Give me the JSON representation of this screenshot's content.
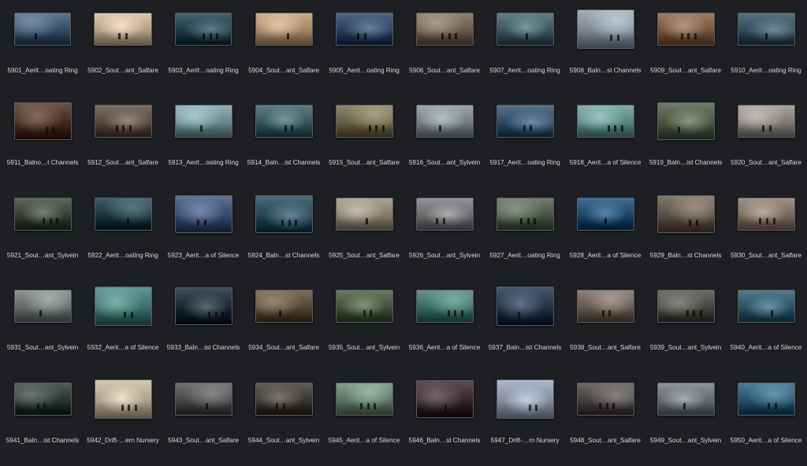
{
  "browser": {
    "items": [
      {
        "name": "5901_Aerit…oating Ring",
        "theme": "#3a5268"
      },
      {
        "name": "5902_Sout…ant_Salfare",
        "theme": "#b8a58a"
      },
      {
        "name": "5903_Aerit…oating Ring",
        "theme": "#23414a"
      },
      {
        "name": "5904_Sout…ant_Salfare",
        "theme": "#a88a68"
      },
      {
        "name": "5905_Aerit…oating Ring",
        "theme": "#2d4460"
      },
      {
        "name": "5906_Sout…ant_Salfare",
        "theme": "#6e5f50"
      },
      {
        "name": "5907_Aerit…oating Ring",
        "theme": "#3e5a63"
      },
      {
        "name": "5908_Baln…st Channels",
        "theme": "#7f8c95"
      },
      {
        "name": "5909_Sout…ant_Salfare",
        "theme": "#7a5a42"
      },
      {
        "name": "5910_Aerit…oating Ring",
        "theme": "#36505e"
      },
      {
        "name": "5911_Balno…t Channels",
        "theme": "#4a3024"
      },
      {
        "name": "5912_Sout…ant_Salfare",
        "theme": "#5a4c40"
      },
      {
        "name": "5913_Aerit…oating Ring",
        "theme": "#6f8d90"
      },
      {
        "name": "5914_Baln…ist Channels",
        "theme": "#3c5b60"
      },
      {
        "name": "5915_Sout…ant_Salfare",
        "theme": "#6b6448"
      },
      {
        "name": "5916_Sout…ant_Sylvein",
        "theme": "#7a8488"
      },
      {
        "name": "5917_Aerit…oating Ring",
        "theme": "#33506b"
      },
      {
        "name": "5918_Aerit…a of Silence",
        "theme": "#5d8a85"
      },
      {
        "name": "5919_Baln…ist Channels",
        "theme": "#4f5a46"
      },
      {
        "name": "5920_Sout…ant_Salfare",
        "theme": "#85807a"
      },
      {
        "name": "5921_Sout…ant_Sylvein",
        "theme": "#3a4438"
      },
      {
        "name": "5922_Aerit…oating Ring",
        "theme": "#1e3a44"
      },
      {
        "name": "5923_Aerit…a of Silence",
        "theme": "#3b4f73"
      },
      {
        "name": "5924_Baln…st Channels",
        "theme": "#2a4a5a"
      },
      {
        "name": "5925_Sout…ant_Salfare",
        "theme": "#8a8070"
      },
      {
        "name": "5926_Sout…ant_Sylvein",
        "theme": "#6e7072"
      },
      {
        "name": "5927_Aerit…oating Ring",
        "theme": "#4e5a48"
      },
      {
        "name": "5928_Aerit…a of Silence",
        "theme": "#1f4a6e"
      },
      {
        "name": "5929_Baln…st Channels",
        "theme": "#5e5448"
      },
      {
        "name": "5930_Sout…ant_Salfare",
        "theme": "#7d6e62"
      },
      {
        "name": "5931_Sout…ant_Sylvein",
        "theme": "#6a7070"
      },
      {
        "name": "5932_Aerit…a of Silence",
        "theme": "#3f7470"
      },
      {
        "name": "5933_Baln…ist Channels",
        "theme": "#1d2c35"
      },
      {
        "name": "5934_Sout…ant_Salfare",
        "theme": "#5a4a38"
      },
      {
        "name": "5935_Sout…ant_Sylvein",
        "theme": "#46573e"
      },
      {
        "name": "5936_Aerit…a of Silence",
        "theme": "#3e7066"
      },
      {
        "name": "5937_Baln…ist Channels",
        "theme": "#26364a"
      },
      {
        "name": "5938_Sout…ant_Salfare",
        "theme": "#6a5e52"
      },
      {
        "name": "5939_Sout…ant_Sylvein",
        "theme": "#4c4a44"
      },
      {
        "name": "5940_Aerit…a of Silence",
        "theme": "#2f5868"
      },
      {
        "name": "5941_Baln…ist Channels",
        "theme": "#2e3a34"
      },
      {
        "name": "5942_Drift-…ern Nursery",
        "theme": "#b3a690"
      },
      {
        "name": "5943_Sout…ant_Salfare",
        "theme": "#4c4c4e"
      },
      {
        "name": "5944_Sout…ant_Sylvein",
        "theme": "#3e3a34"
      },
      {
        "name": "5945_Aerit…a of Silence",
        "theme": "#5f7a68"
      },
      {
        "name": "5946_Baln…st Channels",
        "theme": "#3a2a30"
      },
      {
        "name": "5947_Drift-…rn Nursery",
        "theme": "#8a95a8"
      },
      {
        "name": "5948_Sout…ant_Salfare",
        "theme": "#4a4644"
      },
      {
        "name": "5949_Sout…ant_Sylvein",
        "theme": "#6c7074"
      },
      {
        "name": "5950_Aerit…a of Silence",
        "theme": "#2a5870"
      }
    ]
  }
}
